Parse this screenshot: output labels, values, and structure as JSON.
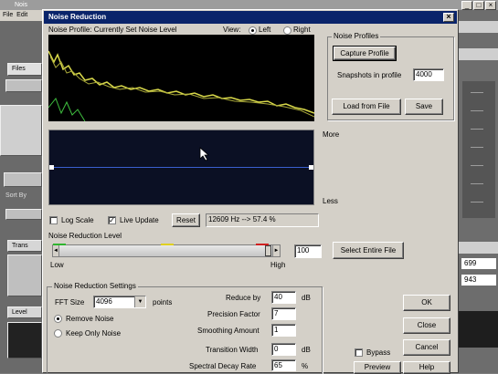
{
  "background_app": {
    "title": "Nois",
    "menu": [
      "File",
      "Edit"
    ],
    "left_labels": [
      "Files",
      "Sort By",
      "Trans",
      "Level"
    ],
    "right_values": [
      "699",
      "943"
    ]
  },
  "dialog": {
    "title": "Noise Reduction",
    "close_glyph": "×",
    "noise_profile_label": "Noise Profile: Currently Set Noise Level",
    "view_label": "View:",
    "view_left": "Left",
    "view_right": "Right",
    "more_label": "More",
    "less_label": "Less",
    "log_scale_label": "Log Scale",
    "live_update_label": "Live Update",
    "reset_label": "Reset",
    "status_readout": "12609 Hz --> 57.4 %",
    "noise_reduction_level_label": "Noise Reduction Level",
    "low_label": "Low",
    "high_label": "High",
    "noise_reduction_level_value": "100",
    "select_entire_file_label": "Select Entire File",
    "profiles": {
      "group_title": "Noise Profiles",
      "capture_label": "Capture Profile",
      "snapshots_label": "Snapshots in profile",
      "snapshots_value": "4000",
      "load_label": "Load from File",
      "save_label": "Save"
    },
    "settings": {
      "group_title": "Noise Reduction Settings",
      "fft_size_label": "FFT Size",
      "fft_size_value": "4096",
      "points_label": "points",
      "remove_noise_label": "Remove Noise",
      "keep_only_noise_label": "Keep Only Noise",
      "reduce_by_label": "Reduce by",
      "reduce_by_value": "40",
      "reduce_by_unit": "dB",
      "precision_factor_label": "Precision Factor",
      "precision_factor_value": "7",
      "smoothing_amount_label": "Smoothing Amount",
      "smoothing_amount_value": "1",
      "transition_width_label": "Transition Width",
      "transition_width_value": "0",
      "transition_width_unit": "dB",
      "spectral_decay_label": "Spectral Decay Rate",
      "spectral_decay_value": "65",
      "spectral_decay_unit": "%"
    },
    "buttons": {
      "ok": "OK",
      "close": "Close",
      "cancel": "Cancel",
      "bypass": "Bypass",
      "preview": "Preview",
      "help": "Help"
    },
    "colors": {
      "title_bar": "#0a246a",
      "spectrum_line": "#d9d94a",
      "spectrum_low": "#3fbf3f",
      "curve_line": "#3a5fd0"
    }
  }
}
